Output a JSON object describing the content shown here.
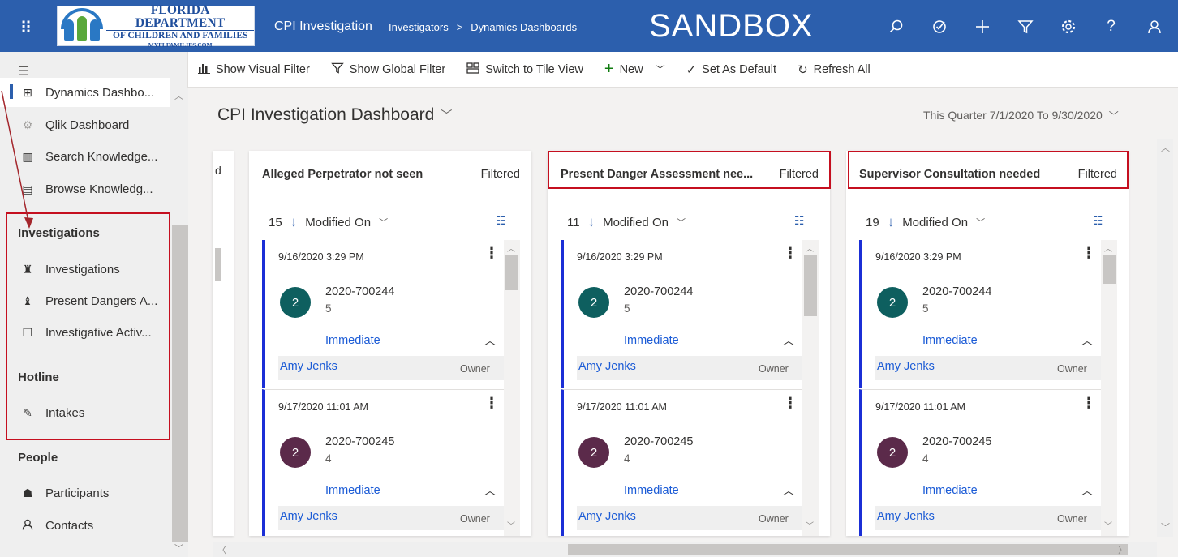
{
  "topbar": {
    "logo_line1": "FLORIDA DEPARTMENT",
    "logo_line2": "OF CHILDREN AND FAMILIES",
    "logo_line3": "MYFLFAMILIES.COM",
    "app_title": "CPI Investigation",
    "breadcrumb": [
      "Investigators",
      ">",
      "Dynamics Dashboards"
    ],
    "environment": "SANDBOX",
    "icons": [
      "search-icon",
      "task-icon",
      "plus-icon",
      "filter-icon",
      "gear-icon",
      "help-icon",
      "user-icon"
    ]
  },
  "commandbar": {
    "show_visual_filter": "Show Visual Filter",
    "show_global_filter": "Show Global Filter",
    "switch_tile_view": "Switch to Tile View",
    "new": "New",
    "set_default": "Set As Default",
    "refresh_all": "Refresh All"
  },
  "nav": {
    "items_top": [
      {
        "label": "Dynamics Dashbo...",
        "icon": "dashboard-icon"
      },
      {
        "label": "Qlik Dashboard",
        "icon": "qlik-icon"
      },
      {
        "label": "Search Knowledge...",
        "icon": "book-icon"
      },
      {
        "label": "Browse Knowledg...",
        "icon": "document-icon"
      }
    ],
    "group_investigations": "Investigations",
    "items_investigations": [
      {
        "label": "Investigations",
        "icon": "investigations-icon"
      },
      {
        "label": "Present Dangers A...",
        "icon": "danger-icon"
      },
      {
        "label": "Investigative Activ...",
        "icon": "activity-icon"
      }
    ],
    "group_hotline": "Hotline",
    "items_hotline": [
      {
        "label": "Intakes",
        "icon": "edit-icon"
      }
    ],
    "group_people": "People",
    "items_people": [
      {
        "label": "Participants",
        "icon": "participants-icon"
      },
      {
        "label": "Contacts",
        "icon": "contact-icon"
      }
    ]
  },
  "dashboard": {
    "title": "CPI Investigation Dashboard",
    "date_range": "This Quarter 7/1/2020 To 9/30/2020"
  },
  "cards": [
    {
      "title": "Alleged Perpetrator not seen",
      "filtered": "Filtered",
      "count": "15",
      "sort": "Modified On",
      "records": [
        {
          "date": "9/16/2020 3:29 PM",
          "avatar": "2",
          "number": "2020-700244",
          "sub": "5",
          "priority": "Immediate",
          "owner": "Amy Jenks",
          "role": "Owner"
        },
        {
          "date": "9/17/2020 11:01 AM",
          "avatar": "2",
          "number": "2020-700245",
          "sub": "4",
          "priority": "Immediate",
          "owner": "Amy Jenks",
          "role": "Owner"
        }
      ]
    },
    {
      "title": "Present Danger Assessment nee...",
      "filtered": "Filtered",
      "count": "11",
      "sort": "Modified On",
      "records": [
        {
          "date": "9/16/2020 3:29 PM",
          "avatar": "2",
          "number": "2020-700244",
          "sub": "5",
          "priority": "Immediate",
          "owner": "Amy Jenks",
          "role": "Owner"
        },
        {
          "date": "9/17/2020 11:01 AM",
          "avatar": "2",
          "number": "2020-700245",
          "sub": "4",
          "priority": "Immediate",
          "owner": "Amy Jenks",
          "role": "Owner"
        }
      ]
    },
    {
      "title": "Supervisor Consultation needed",
      "filtered": "Filtered",
      "count": "19",
      "sort": "Modified On",
      "records": [
        {
          "date": "9/16/2020 3:29 PM",
          "avatar": "2",
          "number": "2020-700244",
          "sub": "5",
          "priority": "Immediate",
          "owner": "Amy Jenks",
          "role": "Owner"
        },
        {
          "date": "9/17/2020 11:01 AM",
          "avatar": "2",
          "number": "2020-700245",
          "sub": "4",
          "priority": "Immediate",
          "owner": "Amy Jenks",
          "role": "Owner"
        }
      ]
    }
  ],
  "partial_card_stub": "d",
  "colors": {
    "topbar": "#2c5fad",
    "highlight_red": "#c50f1f",
    "avatar_teal": "#0e5f5f",
    "avatar_plum": "#5b2a4a",
    "record_accent": "#1b2fd6",
    "link": "#1b5bd6"
  }
}
